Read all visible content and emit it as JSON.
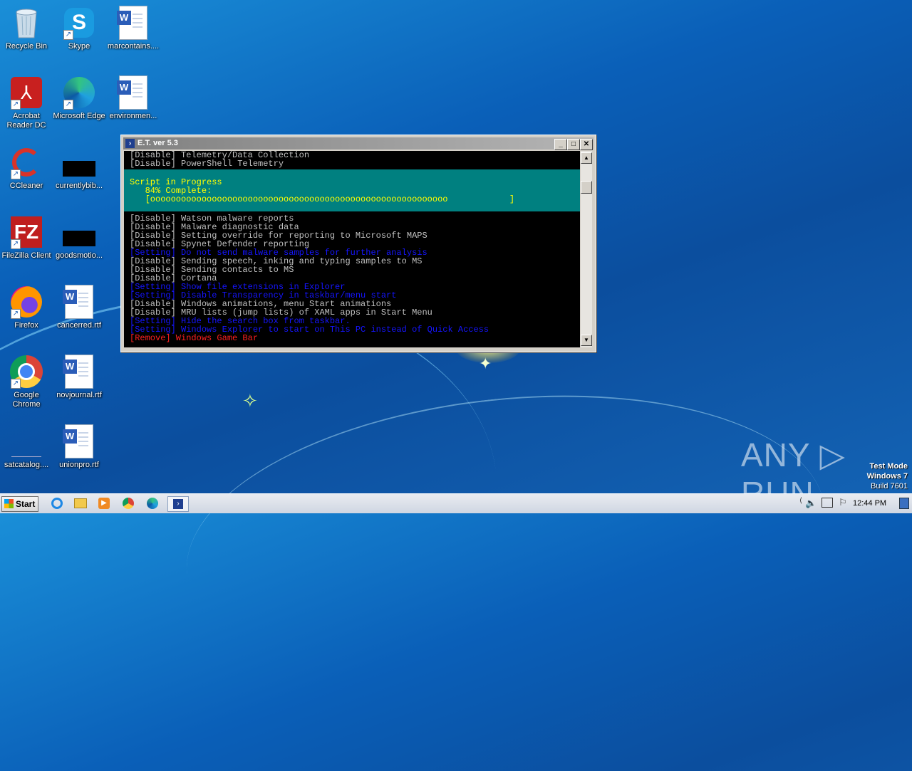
{
  "desktop": {
    "icons": [
      {
        "label": "Recycle Bin"
      },
      {
        "label": "Skype"
      },
      {
        "label": "marcontains...."
      },
      {
        "label": "Acrobat Reader DC"
      },
      {
        "label": "Microsoft Edge"
      },
      {
        "label": "environmen..."
      },
      {
        "label": "CCleaner"
      },
      {
        "label": "currentlybib..."
      },
      {
        "label": "FileZilla Client"
      },
      {
        "label": "goodsmotio..."
      },
      {
        "label": "Firefox"
      },
      {
        "label": "cancerred.rtf"
      },
      {
        "label": "Google Chrome"
      },
      {
        "label": "novjournal.rtf"
      },
      {
        "label": "satcatalog...."
      },
      {
        "label": "unionpro.rtf"
      }
    ]
  },
  "window": {
    "title": "E.T. ver 5.3",
    "lines_before": [
      {
        "text": "[Disable] Telemetry/Data Collection",
        "color": "gray"
      },
      {
        "text": "[Disable] PowerShell Telemetry",
        "color": "gray"
      }
    ],
    "progress": {
      "title": "Script in Progress",
      "percent_text": "   84% Complete:",
      "bar_text": "   [oooooooooooooooooooooooooooooooooooooooooooooooooooooooooo            ]",
      "percent": 84
    },
    "lines_after": [
      {
        "text": "[Disable] Watson malware reports",
        "color": "gray"
      },
      {
        "text": "[Disable] Malware diagnostic data",
        "color": "gray"
      },
      {
        "text": "[Disable] Setting override for reporting to Microsoft MAPS",
        "color": "gray"
      },
      {
        "text": "[Disable] Spynet Defender reporting",
        "color": "gray"
      },
      {
        "text": "[Setting] Do not send malware samples for further analysis",
        "color": "blue"
      },
      {
        "text": "[Disable] Sending speech, inking and typing samples to MS",
        "color": "gray"
      },
      {
        "text": "[Disable] Sending contacts to MS",
        "color": "gray"
      },
      {
        "text": "[Disable] Cortana",
        "color": "gray"
      },
      {
        "text": "[Setting] Show file extensions in Explorer",
        "color": "blue"
      },
      {
        "text": "[Setting] Disable Transparency in taskbar/menu start",
        "color": "blue"
      },
      {
        "text": "[Disable] Windows animations, menu Start animations",
        "color": "gray"
      },
      {
        "text": "[Disable] MRU lists (jump lists) of XAML apps in Start Menu",
        "color": "gray"
      },
      {
        "text": "[Setting] Hide the search box from taskbar.",
        "color": "blue"
      },
      {
        "text": "[Setting] Windows Explorer to start on This PC instead of Quick Access",
        "color": "blue"
      },
      {
        "text": "[Remove] Windows Game Bar",
        "color": "red"
      }
    ]
  },
  "watermark": {
    "brand": "ANY ▷ RUN",
    "mode": "Test Mode",
    "os": "Windows 7",
    "build": "Build 7601"
  },
  "taskbar": {
    "start_label": "Start",
    "clock": "12:44 PM"
  }
}
